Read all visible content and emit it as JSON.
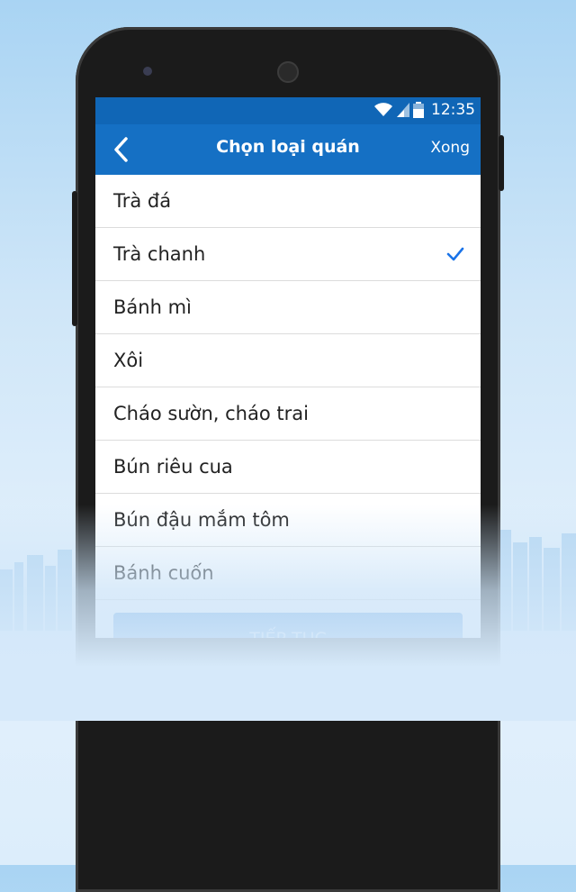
{
  "status_bar": {
    "time": "12:35"
  },
  "header": {
    "back_icon": "chevron-left-icon",
    "title": "Chọn loại quán",
    "done_label": "Xong"
  },
  "list": {
    "items": [
      {
        "label": "Trà đá",
        "selected": false
      },
      {
        "label": "Trà chanh",
        "selected": true
      },
      {
        "label": "Bánh mì",
        "selected": false
      },
      {
        "label": "Xôi",
        "selected": false
      },
      {
        "label": "Cháo sườn, cháo trai",
        "selected": false
      },
      {
        "label": "Bún riêu cua",
        "selected": false
      },
      {
        "label": "Bún đậu mắm tôm",
        "selected": false
      },
      {
        "label": "Bánh cuốn",
        "selected": false
      }
    ]
  },
  "footer": {
    "continue_label": "TIẾP TỤC"
  },
  "colors": {
    "primary": "#1570c4",
    "status_bar": "#1066b6",
    "check": "#1a73e8",
    "button": "#5e9fe0"
  }
}
